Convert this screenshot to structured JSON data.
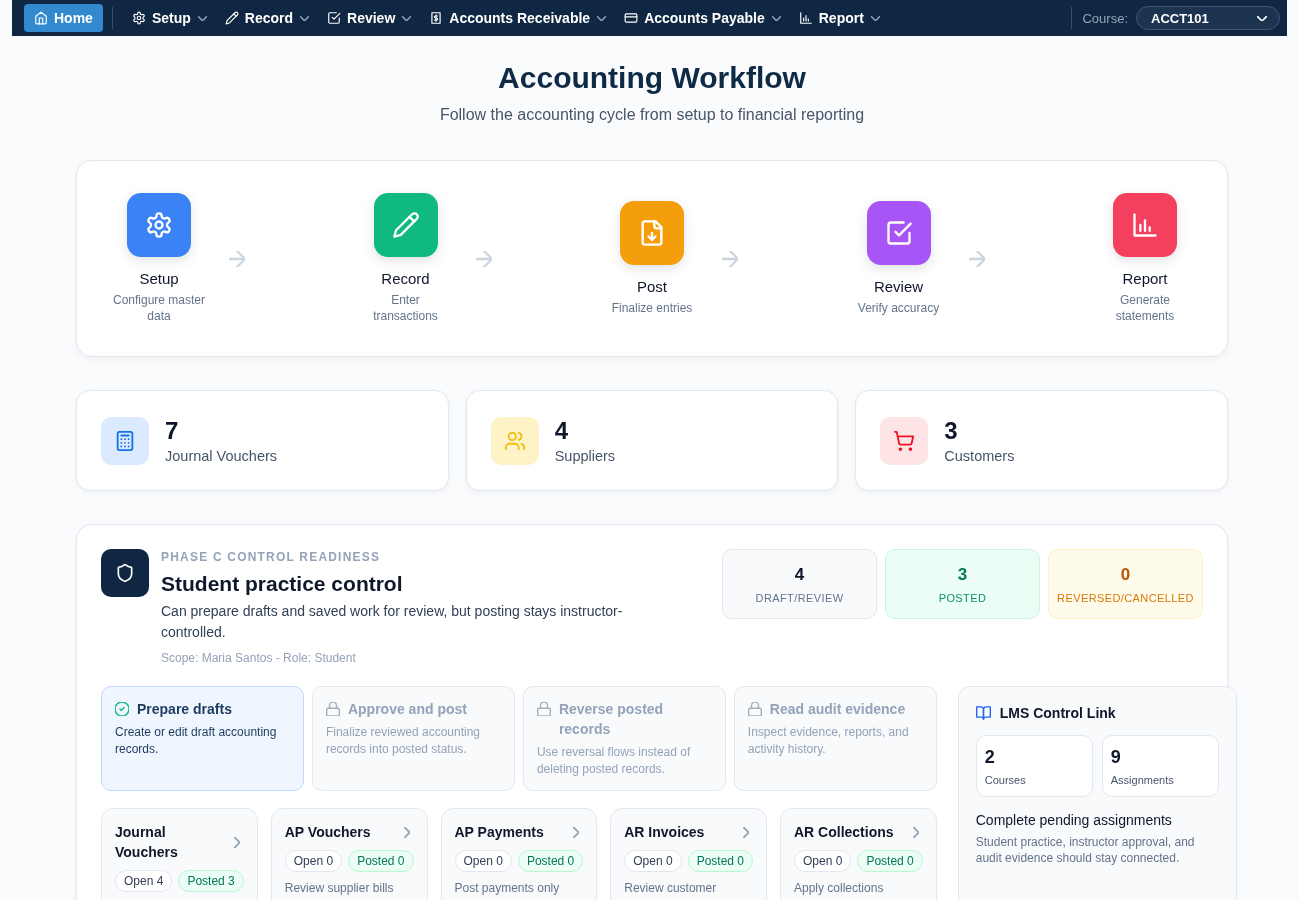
{
  "nav": {
    "items": [
      {
        "label": "Home",
        "kind": "link",
        "selected": true
      },
      {
        "label": "Setup",
        "kind": "menu",
        "selected": false
      },
      {
        "label": "Record",
        "kind": "menu",
        "selected": false
      },
      {
        "label": "Review",
        "kind": "menu",
        "selected": false
      },
      {
        "label": "Accounts Receivable",
        "kind": "menu",
        "selected": false
      },
      {
        "label": "Accounts Payable",
        "kind": "menu",
        "selected": false
      },
      {
        "label": "Report",
        "kind": "menu",
        "selected": false
      }
    ],
    "course": {
      "label": "Course:",
      "value": "ACCT101"
    }
  },
  "header": {
    "title": "Accounting Workflow",
    "subtitle": "Follow the accounting cycle from setup to financial reporting"
  },
  "workflow": {
    "steps": [
      {
        "title": "Setup",
        "description": "Configure master data",
        "color": "#3b82f6"
      },
      {
        "title": "Record",
        "description": "Enter transactions",
        "color": "#10b981"
      },
      {
        "title": "Post",
        "description": "Finalize entries",
        "color": "#f59e0b"
      },
      {
        "title": "Review",
        "description": "Verify accuracy",
        "color": "#a855f7"
      },
      {
        "title": "Report",
        "description": "Generate statements",
        "color": "#f43f5e"
      }
    ]
  },
  "stats": [
    {
      "value": "7",
      "label": "Journal Vouchers",
      "color": "#dbeafe"
    },
    {
      "value": "4",
      "label": "Suppliers",
      "color": "#fef3c7"
    },
    {
      "value": "3",
      "label": "Customers",
      "color": "#ffe4e6"
    }
  ],
  "control": {
    "eyebrow": "PHASE C CONTROL READINESS",
    "title": "Student practice control",
    "description": "Can prepare drafts and saved work for review, but posting stays instructor-controlled.",
    "scope": "Scope: Maria Santos - Role: Student",
    "counters": [
      {
        "value": "4",
        "label": "DRAFT/REVIEW",
        "kind": "neutral"
      },
      {
        "value": "3",
        "label": "POSTED",
        "kind": "success"
      },
      {
        "value": "0",
        "label": "REVERSED/CANCELLED",
        "kind": "warning"
      }
    ],
    "permissions": [
      {
        "title": "Prepare drafts",
        "description": "Create or edit draft accounting records.",
        "allowed": true
      },
      {
        "title": "Approve and post",
        "description": "Finalize reviewed accounting records into posted status.",
        "allowed": false
      },
      {
        "title": "Reverse posted records",
        "description": "Use reversal flows instead of deleting posted records.",
        "allowed": false
      },
      {
        "title": "Read audit evidence",
        "description": "Inspect evidence, reports, and activity history.",
        "allowed": false
      }
    ],
    "modules": [
      {
        "title": "Journal Vouchers",
        "badges": [
          {
            "label": "Open 4",
            "kind": "open"
          },
          {
            "label": "Posted 3",
            "kind": "posted"
          }
        ]
      },
      {
        "title": "AP Vouchers",
        "badges": [
          {
            "label": "Open 0",
            "kind": "open"
          },
          {
            "label": "Posted 0",
            "kind": "posted"
          }
        ],
        "description": "Review supplier bills"
      },
      {
        "title": "AP Payments",
        "badges": [
          {
            "label": "Open 0",
            "kind": "open"
          },
          {
            "label": "Posted 0",
            "kind": "posted"
          }
        ],
        "description": "Post payments only"
      },
      {
        "title": "AR Invoices",
        "badges": [
          {
            "label": "Open 0",
            "kind": "open"
          },
          {
            "label": "Posted 0",
            "kind": "posted"
          }
        ],
        "description": "Review customer"
      },
      {
        "title": "AR Collections",
        "badges": [
          {
            "label": "Open 0",
            "kind": "open"
          },
          {
            "label": "Posted 0",
            "kind": "posted"
          }
        ],
        "description": "Apply collections"
      }
    ],
    "lms": {
      "title": "LMS Control Link",
      "metrics": [
        {
          "value": "2",
          "label": "Courses"
        },
        {
          "value": "9",
          "label": "Assignments"
        }
      ],
      "heading": "Complete pending assignments",
      "description": "Student practice, instructor approval, and audit evidence should stay connected."
    }
  }
}
